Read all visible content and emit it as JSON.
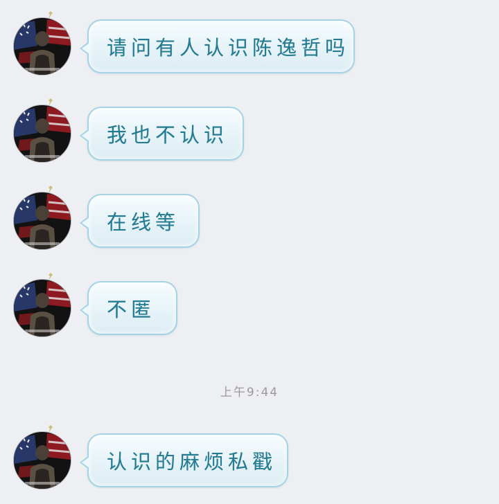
{
  "messages": [
    {
      "text": "请问有人认识陈逸哲吗",
      "avatar_icon": "user-avatar-icon"
    },
    {
      "text": "我也不认识",
      "avatar_icon": "user-avatar-icon"
    },
    {
      "text": "在线等",
      "avatar_icon": "user-avatar-icon"
    },
    {
      "text": "不匿",
      "avatar_icon": "user-avatar-icon"
    },
    {
      "text": "认识的麻烦私戳",
      "avatar_icon": "user-avatar-icon"
    }
  ],
  "timestamp": "上午9:44",
  "colors": {
    "background": "#eeeff3",
    "bubble_border": "#a6d3e3",
    "bubble_text": "#237a91",
    "timestamp_text": "#9a9a9a"
  }
}
